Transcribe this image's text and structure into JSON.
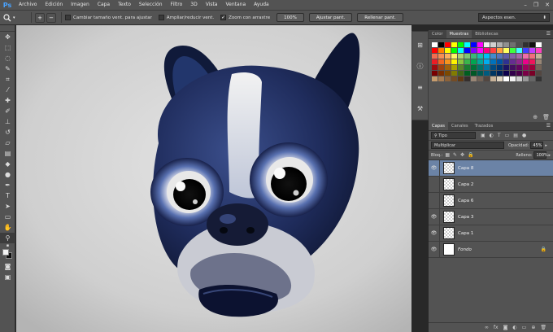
{
  "app": {
    "logo": "Ps"
  },
  "menu": [
    "Archivo",
    "Edición",
    "Imagen",
    "Capa",
    "Texto",
    "Selección",
    "Filtro",
    "3D",
    "Vista",
    "Ventana",
    "Ayuda"
  ],
  "window_controls": {
    "minimize": "–",
    "restore": "❐",
    "close": "✕"
  },
  "options": {
    "resize_windows_label": "Cambiar tamaño vent. para ajustar",
    "zoom_all_label": "Ampliar/reducir vent.",
    "scrubby_zoom_label": "Zoom con arrastre",
    "scrubby_zoom_checked": true,
    "btn_100": "100%",
    "btn_fit": "Ajustar pant.",
    "btn_fill": "Rellenar pant.",
    "workspace": "Aspectos esen."
  },
  "swatches_panel": {
    "tabs": [
      "Color",
      "Muestras",
      "Bibliotecas"
    ],
    "active_tab": "Muestras",
    "colors": [
      "#ffffff",
      "#000000",
      "#ff0000",
      "#ffff00",
      "#00ff00",
      "#00ffff",
      "#0000ff",
      "#ff00ff",
      "#f0f0f0",
      "#d0d0d0",
      "#b0b0b0",
      "#909090",
      "#707070",
      "#505050",
      "#303030",
      "#101010",
      "#ffffff",
      "#ff0000",
      "#ff8000",
      "#ffff00",
      "#00ff00",
      "#00ffff",
      "#0000ff",
      "#8000ff",
      "#ff00ff",
      "#ff0080",
      "#ff4040",
      "#ffa040",
      "#ffff60",
      "#40ff40",
      "#40ffff",
      "#4040ff",
      "#c040ff",
      "#ff40c0",
      "#f26c4f",
      "#f68e55",
      "#fbaf5c",
      "#fff467",
      "#acd372",
      "#7cc576",
      "#3bb878",
      "#1abbb4",
      "#00bff3",
      "#438ccb",
      "#5574b9",
      "#605ca8",
      "#855fa8",
      "#a763a8",
      "#f06ea9",
      "#f26d7d",
      "#c7b299",
      "#ed1c24",
      "#f26522",
      "#f7941d",
      "#fff200",
      "#8dc63f",
      "#39b54a",
      "#00a651",
      "#00a99d",
      "#00aeef",
      "#0072bc",
      "#0054a6",
      "#2e3192",
      "#662d91",
      "#92278f",
      "#ec008c",
      "#ed145b",
      "#998675",
      "#9e0b0f",
      "#a0410d",
      "#a3620a",
      "#aba000",
      "#598527",
      "#1a7b30",
      "#007236",
      "#00746b",
      "#0076a3",
      "#004a80",
      "#003471",
      "#1b1464",
      "#440e62",
      "#630460",
      "#9e005d",
      "#9e0039",
      "#736357",
      "#790000",
      "#7b2e00",
      "#7d4900",
      "#827b00",
      "#406618",
      "#005e20",
      "#005826",
      "#005952",
      "#005b7f",
      "#003663",
      "#002157",
      "#0d004c",
      "#32004b",
      "#4b0049",
      "#7b0046",
      "#7a0026",
      "#534741",
      "#c69c6d",
      "#a67c52",
      "#8c6239",
      "#754c24",
      "#603913",
      "#362f2d",
      "#998675",
      "#736357",
      "#534741",
      "#c7b299",
      "#e0d4c2",
      "#ffffff",
      "#f2f2f2",
      "#cccccc",
      "#999999",
      "#666666",
      "#333333"
    ]
  },
  "layers_panel": {
    "tabs": [
      "Capas",
      "Canales",
      "Trazados"
    ],
    "active_tab": "Capas",
    "kind": "Tipo",
    "blend_mode": "Multiplicar",
    "opacity_label": "Opacidad:",
    "opacity": "45%",
    "lock_label": "Bloq.:",
    "fill_label": "Relleno:",
    "fill": "100%",
    "layers": [
      {
        "name": "Capa 8",
        "visible": true,
        "selected": true,
        "italic": false,
        "locked": false,
        "thumb": "transparent"
      },
      {
        "name": "Capa 2",
        "visible": false,
        "selected": false,
        "italic": false,
        "locked": false,
        "thumb": "transparent"
      },
      {
        "name": "Capa 6",
        "visible": false,
        "selected": false,
        "italic": false,
        "locked": false,
        "thumb": "transparent"
      },
      {
        "name": "Capa 3",
        "visible": true,
        "selected": false,
        "italic": false,
        "locked": false,
        "thumb": "transparent"
      },
      {
        "name": "Capa 1",
        "visible": true,
        "selected": false,
        "italic": false,
        "locked": false,
        "thumb": "transparent"
      },
      {
        "name": "Fondo",
        "visible": true,
        "selected": false,
        "italic": true,
        "locked": true,
        "thumb": "white"
      }
    ]
  }
}
